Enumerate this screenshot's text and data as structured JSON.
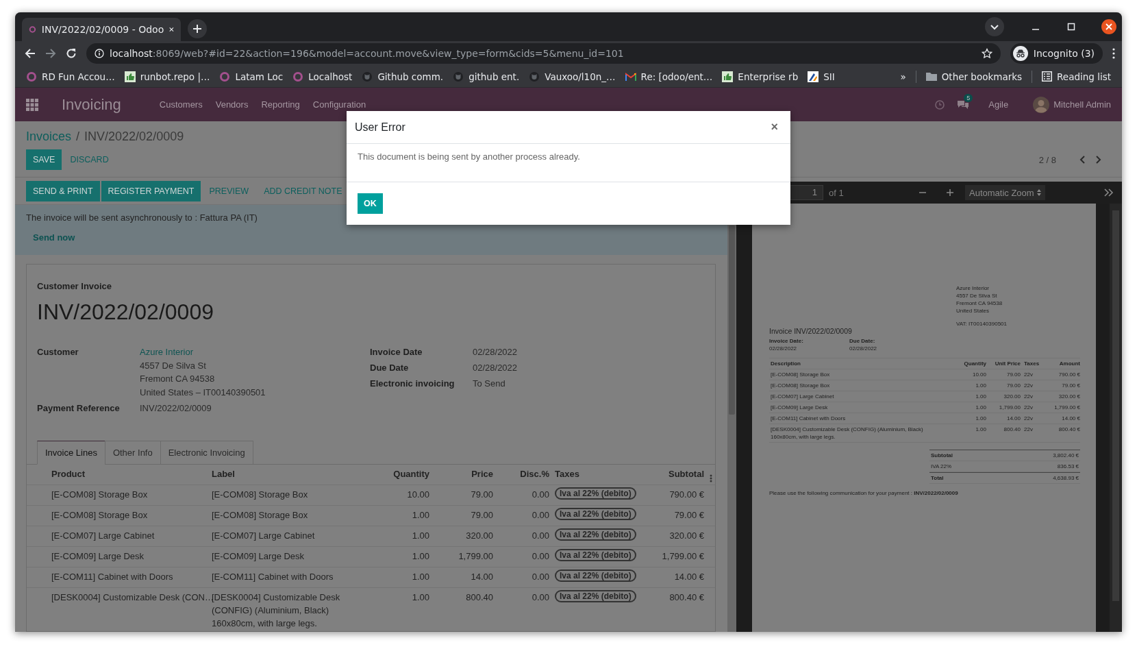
{
  "browser": {
    "tabs": [
      {
        "title": "INV/2022/02/0009 - Odoo",
        "selected": true
      }
    ],
    "address": {
      "host": "localhost",
      "path": ":8069/web?#id=22&action=196&model=account.move&view_type=form&cids=5&menu_id=101"
    },
    "profile": "Incognito (3)",
    "bookmarks": [
      {
        "label": "RD Fun Accou…",
        "kind": "ring"
      },
      {
        "label": "runbot.repo |…",
        "kind": "thumb"
      },
      {
        "label": "Latam Loc",
        "kind": "ring"
      },
      {
        "label": "Localhost",
        "kind": "ring"
      },
      {
        "label": "Github comm.",
        "kind": "cat"
      },
      {
        "label": "github ent.",
        "kind": "cat"
      },
      {
        "label": "Vauxoo/l10n_…",
        "kind": "cat"
      },
      {
        "label": "Re: [odoo/ent…",
        "kind": "mail"
      },
      {
        "label": "Enterprise rb",
        "kind": "thumb"
      },
      {
        "label": "SII",
        "kind": "logo"
      }
    ],
    "more": "»",
    "other_bookmarks": "Other bookmarks",
    "reading_list": "Reading list"
  },
  "navbar": {
    "app": "Invoicing",
    "menus": [
      "Customers",
      "Vendors",
      "Reporting",
      "Configuration"
    ],
    "message_count": "5",
    "company": "Agile",
    "user": "Mitchell Admin"
  },
  "control_panel": {
    "breadcrumb": {
      "parent": "Invoices",
      "separator": "/",
      "current": "INV/2022/02/0009"
    },
    "buttons": [
      {
        "label": "SAVE",
        "kind": "primary"
      },
      {
        "label": "DISCARD",
        "kind": "link"
      }
    ],
    "pager": "2 / 8"
  },
  "statusbar": {
    "buttons": [
      {
        "label": "SEND & PRINT",
        "kind": "primary"
      },
      {
        "label": "REGISTER PAYMENT",
        "kind": "primary"
      },
      {
        "label": "PREVIEW",
        "kind": "link"
      },
      {
        "label": "ADD CREDIT NOTE",
        "kind": "link"
      }
    ]
  },
  "alert": {
    "message": "The invoice will be sent asynchronously to : Fattura PA (IT)",
    "action": "Send now"
  },
  "sheet": {
    "subtitle": "Customer Invoice",
    "title": "INV/2022/02/0009",
    "left_fields": [
      {
        "label": "Customer",
        "kind": "address",
        "link": "Azure Interior",
        "lines": [
          "4557 De Silva St",
          "Fremont CA 94538",
          "United States – IT00140390501"
        ]
      },
      {
        "label": "Payment Reference",
        "kind": "text",
        "value": "INV/2022/02/0009"
      }
    ],
    "right_fields": [
      {
        "label": "Invoice Date",
        "value": "02/28/2022"
      },
      {
        "label": "Due Date",
        "value": "02/28/2022"
      },
      {
        "label": "Electronic invoicing",
        "value": "To Send"
      }
    ],
    "tabs": [
      {
        "label": "Invoice Lines",
        "selected": true
      },
      {
        "label": "Other Info",
        "selected": false
      },
      {
        "label": "Electronic Invoicing",
        "selected": false
      }
    ],
    "columns": [
      "Product",
      "Label",
      "Quantity",
      "Price",
      "Disc.%",
      "Taxes",
      "Subtotal"
    ],
    "rows": [
      {
        "product": "[E-COM08] Storage Box",
        "label": "[E-COM08] Storage Box",
        "quantity": "10.00",
        "price": "79.00",
        "discount": "0.00",
        "tax": "Iva al 22% (debito)",
        "subtotal": "790.00 €"
      },
      {
        "product": "[E-COM08] Storage Box",
        "label": "[E-COM08] Storage Box",
        "quantity": "1.00",
        "price": "79.00",
        "discount": "0.00",
        "tax": "Iva al 22% (debito)",
        "subtotal": "79.00 €"
      },
      {
        "product": "[E-COM07] Large Cabinet",
        "label": "[E-COM07] Large Cabinet",
        "quantity": "1.00",
        "price": "320.00",
        "discount": "0.00",
        "tax": "Iva al 22% (debito)",
        "subtotal": "320.00 €"
      },
      {
        "product": "[E-COM09] Large Desk",
        "label": "[E-COM09] Large Desk",
        "quantity": "1.00",
        "price": "1,799.00",
        "discount": "0.00",
        "tax": "Iva al 22% (debito)",
        "subtotal": "1,799.00 €"
      },
      {
        "product": "[E-COM11] Cabinet with Doors",
        "label": "[E-COM11] Cabinet with Doors",
        "quantity": "1.00",
        "price": "14.00",
        "discount": "0.00",
        "tax": "Iva al 22% (debito)",
        "subtotal": "14.00 €"
      },
      {
        "product": "[DESK0004] Customizable Desk (CON…",
        "label": "[DESK0004] Customizable Desk (CONFIG) (Aluminium, Black)\n160x80cm, with large legs.",
        "quantity": "1.00",
        "price": "800.40",
        "discount": "0.00",
        "tax": "Iva al 22% (debito)",
        "subtotal": "800.40 €"
      }
    ]
  },
  "pdf_viewer": {
    "page": "1",
    "page_count": "of 1",
    "zoom": "Automatic Zoom",
    "document": {
      "address": [
        "Azure Interior",
        "4557 De Silva St",
        "Fremont CA 94538",
        "United States"
      ],
      "vat": "VAT: IT00140390501",
      "title": "Invoice INV/2022/02/0009",
      "dates": [
        {
          "label": "Invoice Date:",
          "value": "02/28/2022"
        },
        {
          "label": "Due Date:",
          "value": "02/28/2022"
        }
      ],
      "columns": [
        "Description",
        "Quantity",
        "Unit Price",
        "Taxes",
        "Amount"
      ],
      "rows": [
        {
          "description": "[E-COM08] Storage Box",
          "quantity": "10.00",
          "unit_price": "79.00",
          "taxes": "22v",
          "amount": "790.00 €"
        },
        {
          "description": "[E-COM08] Storage Box",
          "quantity": "1.00",
          "unit_price": "79.00",
          "taxes": "22v",
          "amount": "79.00 €"
        },
        {
          "description": "[E-COM07] Large Cabinet",
          "quantity": "1.00",
          "unit_price": "320.00",
          "taxes": "22v",
          "amount": "320.00 €"
        },
        {
          "description": "[E-COM09] Large Desk",
          "quantity": "1.00",
          "unit_price": "1,799.00",
          "taxes": "22v",
          "amount": "1,799.00 €"
        },
        {
          "description": "[E-COM11] Cabinet with Doors",
          "quantity": "1.00",
          "unit_price": "14.00",
          "taxes": "22v",
          "amount": "14.00 €"
        },
        {
          "description": "[DESK0004] Customizable Desk (CONFIG) (Aluminium, Black)\n160x80cm, with large legs.",
          "quantity": "1.00",
          "unit_price": "800.40",
          "taxes": "22v",
          "amount": "800.40 €"
        }
      ],
      "totals": [
        {
          "label": "Subtotal",
          "value": "3,802.40 €",
          "kind": "bold"
        },
        {
          "label": "IVA 22%",
          "value": "836.53 €",
          "kind": "plain"
        },
        {
          "label": "Total",
          "value": "4,638.93 €",
          "kind": "bold"
        }
      ],
      "communication": "Please use the following communication for your payment : **INV/2022/02/0009**"
    }
  },
  "dialog": {
    "title": "User Error",
    "close": "×",
    "message": "This document is being sent by another process already.",
    "button": "OK"
  }
}
